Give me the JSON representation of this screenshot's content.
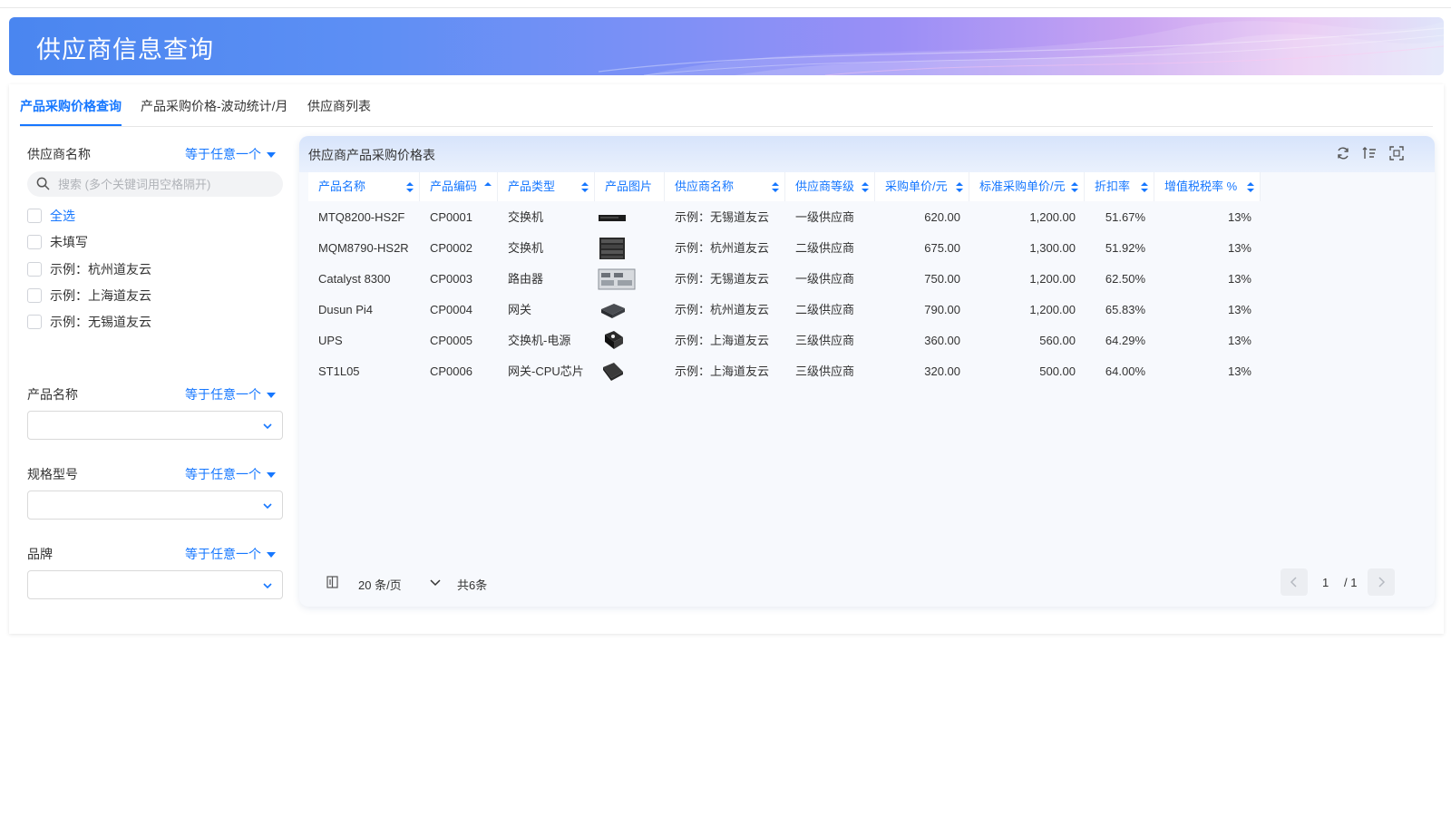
{
  "header": {
    "title": "供应商信息查询"
  },
  "tabs": [
    {
      "label": "产品采购价格查询",
      "active": true
    },
    {
      "label": "产品采购价格-波动统计/月",
      "active": false
    },
    {
      "label": "供应商列表",
      "active": false
    }
  ],
  "filters": {
    "supplier": {
      "label": "供应商名称",
      "operator": "等于任意一个",
      "search_placeholder": "搜索 (多个关键词用空格隔开)",
      "options": [
        "全选",
        "未填写",
        "示例：杭州道友云",
        "示例：上海道友云",
        "示例：无锡道友云"
      ]
    },
    "product": {
      "label": "产品名称",
      "operator": "等于任意一个"
    },
    "model": {
      "label": "规格型号",
      "operator": "等于任意一个"
    },
    "brand": {
      "label": "品牌",
      "operator": "等于任意一个"
    }
  },
  "grid": {
    "title": "供应商产品采购价格表",
    "columns": [
      "产品名称",
      "产品编码",
      "产品类型",
      "产品图片",
      "供应商名称",
      "供应商等级",
      "采购单价/元",
      "标准采购单价/元",
      "折扣率",
      "增值税税率 %"
    ],
    "rows": [
      {
        "name": "MTQ8200-HS2F",
        "code": "CP0001",
        "type": "交换机",
        "image": "switch-1u-thumbnail",
        "supplier": "示例：无锡道友云",
        "level": "一级供应商",
        "price": "620.00",
        "std_price": "1,200.00",
        "discount": "51.67%",
        "tax": "13%"
      },
      {
        "name": "MQM8790-HS2R",
        "code": "CP0002",
        "type": "交换机",
        "image": "switch-stack-thumbnail",
        "supplier": "示例：杭州道友云",
        "level": "二级供应商",
        "price": "675.00",
        "std_price": "1,300.00",
        "discount": "51.92%",
        "tax": "13%"
      },
      {
        "name": "Catalyst 8300",
        "code": "CP0003",
        "type": "路由器",
        "image": "router-thumbnail",
        "supplier": "示例：无锡道友云",
        "level": "一级供应商",
        "price": "750.00",
        "std_price": "1,200.00",
        "discount": "62.50%",
        "tax": "13%"
      },
      {
        "name": "Dusun Pi4",
        "code": "CP0004",
        "type": "网关",
        "image": "gateway-thumbnail",
        "supplier": "示例：杭州道友云",
        "level": "二级供应商",
        "price": "790.00",
        "std_price": "1,200.00",
        "discount": "65.83%",
        "tax": "13%"
      },
      {
        "name": "UPS",
        "code": "CP0005",
        "type": "交换机-电源",
        "image": "power-module-thumbnail",
        "supplier": "示例：上海道友云",
        "level": "三级供应商",
        "price": "360.00",
        "std_price": "560.00",
        "discount": "64.29%",
        "tax": "13%"
      },
      {
        "name": "ST1L05",
        "code": "CP0006",
        "type": "网关-CPU芯片",
        "image": "chip-thumbnail",
        "supplier": "示例：上海道友云",
        "level": "三级供应商",
        "price": "320.00",
        "std_price": "500.00",
        "discount": "64.00%",
        "tax": "13%"
      }
    ],
    "pagination": {
      "page_size": "20 条/页",
      "total": "共6条",
      "current": "1",
      "pages": "/ 1"
    }
  },
  "colors": {
    "accent": "#1677ff",
    "banner_start": "#4a86f0",
    "banner_end": "#e8c7f3"
  }
}
